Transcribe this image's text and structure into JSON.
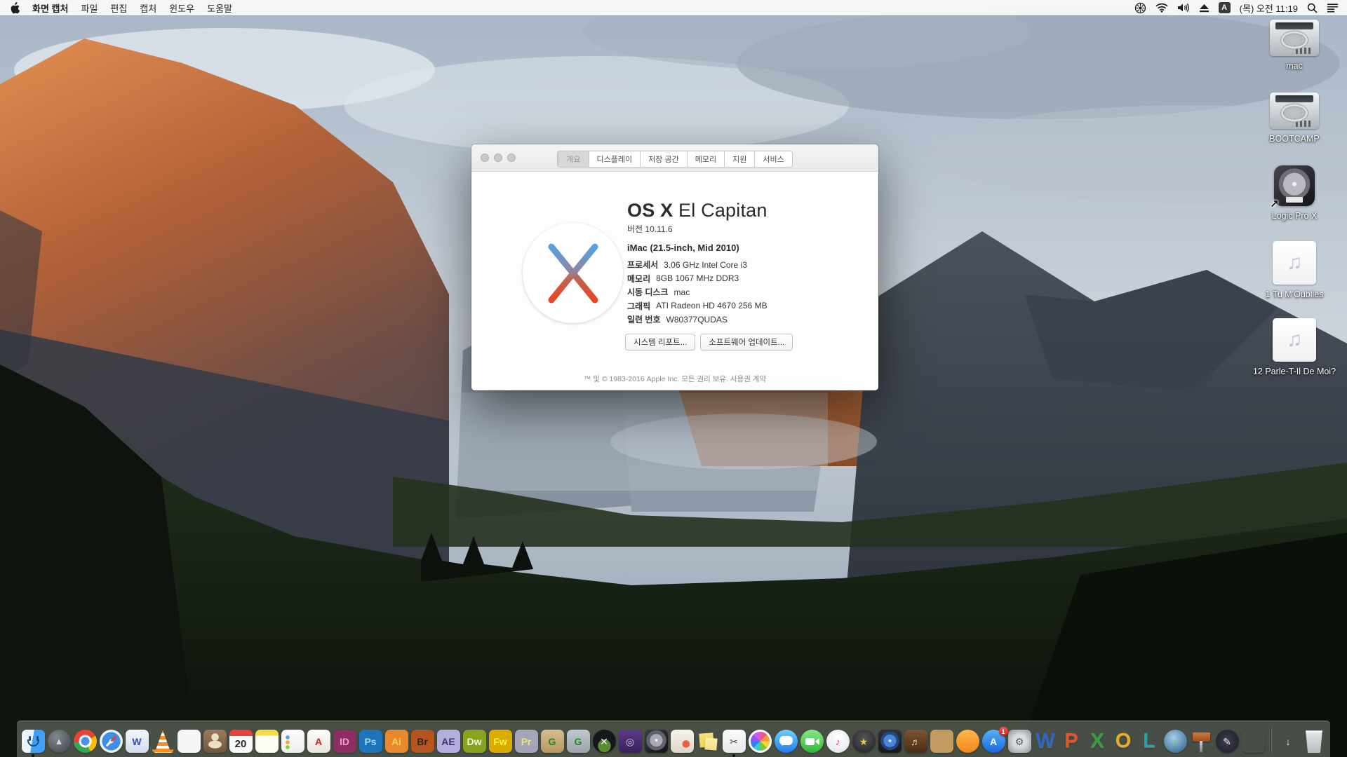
{
  "menu_bar": {
    "app_name": "화면 캡처",
    "menus": [
      "파일",
      "편집",
      "캡처",
      "윈도우",
      "도움말"
    ],
    "input_source": "A",
    "clock": "(목) 오전 11:19",
    "status_icon_names": [
      "fan-icon",
      "wifi-icon",
      "volume-icon",
      "eject-icon",
      "input-source-badge",
      "clock",
      "spotlight-icon",
      "notification-center-icon"
    ]
  },
  "about_window": {
    "tabs": [
      {
        "label": "개요",
        "selected": true
      },
      {
        "label": "디스플레이"
      },
      {
        "label": "저장 공간"
      },
      {
        "label": "메모리"
      },
      {
        "label": "지원"
      },
      {
        "label": "서비스"
      }
    ],
    "title_strong": "OS X",
    "title_light": " El Capitan",
    "version": "버전 10.11.6",
    "model": "iMac (21.5-inch, Mid 2010)",
    "specs": [
      {
        "label": "프로세서",
        "value": "3.06 GHz Intel Core i3"
      },
      {
        "label": "메모리",
        "value": "8GB 1067 MHz DDR3"
      },
      {
        "label": "시동 디스크",
        "value": "mac"
      },
      {
        "label": "그래픽",
        "value": "ATI Radeon HD 4670 256 MB"
      },
      {
        "label": "일련 번호",
        "value": "W80377QUDAS"
      }
    ],
    "buttons": [
      "시스템 리포트...",
      "소프트웨어 업데이트..."
    ],
    "footer": "™ 및 © 1983-2016 Apple Inc. 모든 권리 보유. 사용권 계약"
  },
  "desktop_icons": [
    {
      "label": "mac",
      "type": "drive"
    },
    {
      "label": "BOOTCAMP",
      "type": "drive"
    },
    {
      "label": "Logic Pro X",
      "type": "logic"
    },
    {
      "label": "1 Tu M'Oublies",
      "type": "music"
    },
    {
      "label": "12 Parle-T-Il De Moi?",
      "type": "music"
    }
  ],
  "dock": {
    "items": [
      {
        "name": "finder",
        "shape": "square",
        "bg": "linear-gradient(100deg,#e9f4fd 46%,#3fa0f5 46%)",
        "running": true
      },
      {
        "name": "launchpad",
        "shape": "circle",
        "bg": "radial-gradient(circle at 38% 32%,#80888f,#3d4247)",
        "glyph": "▲",
        "fg": "#d5d9dd"
      },
      {
        "name": "chrome",
        "shape": "circle",
        "bg": "radial-gradient(circle,#4a90e8 0 6px,#fff 6px 9px,rgba(0,0,0,0) 9px),conic-gradient(from -45deg,#e84335 0 30%,#fbbc05 30% 55%,#34a853 55% 85%,#e84335 85%)"
      },
      {
        "name": "safari",
        "shape": "circle",
        "bg": "radial-gradient(circle,#d7ecfa 0 3px,#3e8ee8 3px 13px,#eaf3fa 13px)"
      },
      {
        "name": "w-web-app",
        "shape": "square",
        "bg": "linear-gradient(#f4f7fb,#d3dcef)",
        "glyph": "W",
        "fg": "#2e4fb4"
      },
      {
        "name": "vlc",
        "shape": "cone"
      },
      {
        "name": "photo-viewer",
        "shape": "square",
        "bg": "#f5f5f5"
      },
      {
        "name": "contacts",
        "shape": "square",
        "bg": "radial-gradient(circle at 50% 32%,#ecdfc8 0 5px,rgba(0,0,0,0) 5.5px),radial-gradient(12px 7px at 50% 64%,#ecdfc8 0 9px,rgba(0,0,0,0) 10px),linear-gradient(#9b7b5b,#6f553d)"
      },
      {
        "name": "calendar",
        "shape": "square",
        "bg": "linear-gradient(#e8453a 0 27%,#fafafa 27%)",
        "glyph": "20",
        "fg": "#2a2a2a"
      },
      {
        "name": "notes",
        "shape": "square",
        "bg": "linear-gradient(#f7d94c 0 26%,#fdfcf5 26%)"
      },
      {
        "name": "reminders",
        "shape": "square",
        "bg": "radial-gradient(circle at 9px 11px,#4aa3f5 0 2.5px,rgba(0,0,0,0) 3px),radial-gradient(circle at 9px 18px,#f5a623 0 2.5px,rgba(0,0,0,0) 3px),radial-gradient(circle at 9px 25px,#7ed321 0 2.5px,rgba(0,0,0,0) 3px),linear-gradient(#fcfcfc,#eeeeee)"
      },
      {
        "name": "acrobat",
        "shape": "square",
        "bg": "linear-gradient(#fdfdfc,#eae6de)",
        "glyph": "A",
        "fg": "#d21f2a"
      },
      {
        "name": "indesign",
        "shape": "square",
        "bg": "#8e2d63",
        "glyph": "ID",
        "fg": "#eba4c9"
      },
      {
        "name": "photoshop",
        "shape": "square",
        "bg": "#1c75bc",
        "glyph": "Ps",
        "fg": "#a9d7f7"
      },
      {
        "name": "illustrator",
        "shape": "square",
        "bg": "#e8872b",
        "glyph": "Ai",
        "fg": "#f8d64e"
      },
      {
        "name": "bridge",
        "shape": "square",
        "bg": "#b5541f",
        "glyph": "Br",
        "fg": "#38220e"
      },
      {
        "name": "after-effects",
        "shape": "square",
        "bg": "#b3aedd",
        "glyph": "AE",
        "fg": "#3c3766"
      },
      {
        "name": "dreamweaver",
        "shape": "square",
        "bg": "#8aa31e",
        "glyph": "Dw",
        "fg": "#f2f7da"
      },
      {
        "name": "fireworks",
        "shape": "square",
        "bg": "#dcab00",
        "glyph": "Fw",
        "fg": "#fff04a"
      },
      {
        "name": "premiere",
        "shape": "square",
        "bg": "#a5a5ba",
        "glyph": "Pr",
        "fg": "#ece28a"
      },
      {
        "name": "stuffit-expander",
        "shape": "square",
        "bg": "linear-gradient(#d8bd8e,#b69763)",
        "glyph": "G",
        "fg": "#1e8a1e"
      },
      {
        "name": "dropstuff",
        "shape": "square",
        "bg": "linear-gradient(#c2c9cf,#9aa3ab)",
        "glyph": "G",
        "fg": "#1e8a1e"
      },
      {
        "name": "x-utility",
        "shape": "circle",
        "bg": "radial-gradient(circle at 50% 70%,#5a8a33 0 32%,#15181a 33%)",
        "glyph": "✕",
        "fg": "#f2f2f2"
      },
      {
        "name": "toast",
        "shape": "square",
        "bg": "linear-gradient(#5c3b84,#37215c)",
        "glyph": "◎",
        "fg": "#cdd1e8"
      },
      {
        "name": "logic-pro",
        "shape": "square",
        "bg": "radial-gradient(circle at 50% 46%,#f0f0f4 0 2px,#aaaab4 2px 9px,#62626c 9px 14px,rgba(0,0,0,0) 14.5px),linear-gradient(140deg,#3c3c44,#121216)"
      },
      {
        "name": "compass-docs",
        "shape": "square",
        "bg": "radial-gradient(circle at 66% 62%,#e8613a 0 5px,rgba(0,0,0,0) 5.5px),linear-gradient(#f7f4ed,#ded7c7)"
      },
      {
        "name": "stickies",
        "shape": "art"
      },
      {
        "name": "grab",
        "shape": "square",
        "bg": "linear-gradient(#fbfbfb,#e9e9e9)",
        "glyph": "✂",
        "fg": "#444444",
        "running": true
      },
      {
        "name": "photos",
        "shape": "circle"
      },
      {
        "name": "messages",
        "shape": "circle",
        "bg": "linear-gradient(#6fd0fb,#1e7df2)"
      },
      {
        "name": "facetime",
        "shape": "circle",
        "bg": "linear-gradient(#8ae88a,#2eb833)"
      },
      {
        "name": "itunes",
        "shape": "circle",
        "bg": "radial-gradient(circle at 50% 32%,#ffffff,#ececf2 65%,#d9d9e2)",
        "glyph": "♪",
        "fg": "#e8468a"
      },
      {
        "name": "imovie",
        "shape": "circle",
        "bg": "radial-gradient(circle at 50% 38%,#54545a,#1e1e22)",
        "glyph": "★",
        "fg": "#e8c44a"
      },
      {
        "name": "idvd",
        "shape": "square",
        "bg": "radial-gradient(circle at 50% 48%,#dceafc 0 2px,#4a86d8 2px 9px,#24477e 9px 13px,rgba(0,0,0,0) 13.5px),linear-gradient(#303038,#17171c)"
      },
      {
        "name": "garageband",
        "shape": "square",
        "bg": "linear-gradient(#7c5433,#4a2d15)",
        "glyph": "♬",
        "fg": "#e9d1a2"
      },
      {
        "name": "cork-board",
        "shape": "square",
        "bg": "#c29b63"
      },
      {
        "name": "ibooks",
        "shape": "circle",
        "bg": "linear-gradient(#ffb84a,#f2871d)"
      },
      {
        "name": "app-store",
        "shape": "circle",
        "bg": "linear-gradient(#55b2f6,#1a67e2)",
        "glyph": "A",
        "fg": "#ffffff",
        "badge": "1"
      },
      {
        "name": "system-preferences",
        "shape": "square",
        "bg": "radial-gradient(circle,#dadcdf 0 38%,#9ba1a8 85%)",
        "glyph": "⚙",
        "fg": "#585d64"
      },
      {
        "name": "ms-word",
        "shape": "letter",
        "glyph": "W",
        "fg": "#2d66c4"
      },
      {
        "name": "ms-powerpoint",
        "shape": "letter",
        "glyph": "P",
        "fg": "#e0562a"
      },
      {
        "name": "ms-excel",
        "shape": "letter",
        "glyph": "X",
        "fg": "#3a9e3a"
      },
      {
        "name": "ms-outlook",
        "shape": "letter",
        "glyph": "O",
        "fg": "#e9ae22"
      },
      {
        "name": "ms-lync",
        "shape": "letter",
        "glyph": "L",
        "fg": "#28a0ae"
      },
      {
        "name": "web-downloader",
        "shape": "circle",
        "bg": "radial-gradient(circle at 42% 35%,#a6cdea,#49799f 72%,#2c5a83)",
        "glyph": "↓",
        "fg": "#46d446"
      },
      {
        "name": "keynote",
        "shape": "art"
      },
      {
        "name": "scrivener",
        "shape": "circle",
        "bg": "radial-gradient(circle,#3d3d4c,#1d1d28)",
        "glyph": "✎",
        "fg": "#e9e9f2"
      },
      {
        "name": "chart-app",
        "shape": "square"
      },
      {
        "type": "separator"
      },
      {
        "name": "downloads-folder",
        "shape": "art",
        "glyph": "↓",
        "fg": "#d9ecfb"
      },
      {
        "name": "trash",
        "shape": "art"
      }
    ]
  }
}
